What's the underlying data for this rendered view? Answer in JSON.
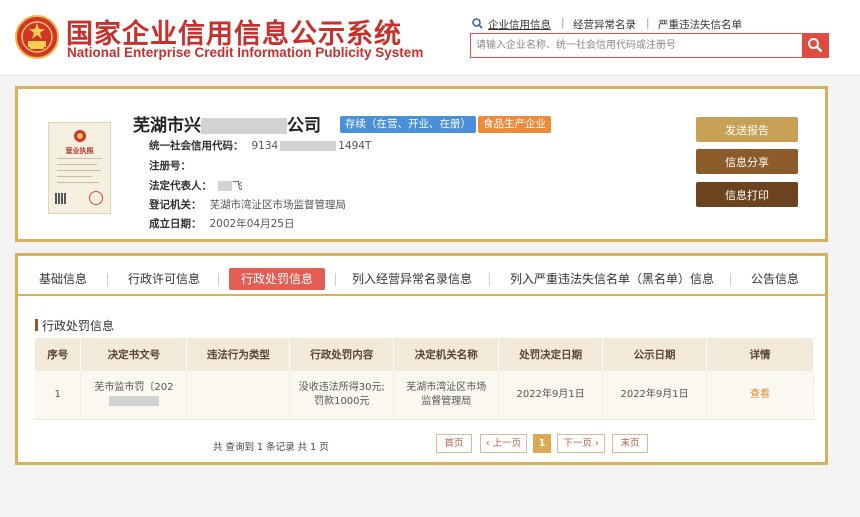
{
  "header": {
    "title_cn": "国家企业信用信息公示系统",
    "title_en": "National Enterprise Credit Information Publicity System",
    "nav": [
      {
        "label": "企业信用信息"
      },
      {
        "label": "经营异常名录"
      },
      {
        "label": "严重违法失信名单"
      }
    ],
    "search": {
      "value": "",
      "placeholder": "请输入企业名称、统一社会信用代码或注册号"
    }
  },
  "company": {
    "license_label": "营业执照",
    "name_visible_prefix": "芜湖市兴",
    "name_visible_suffix": "公司",
    "status_badge": "存续（在营、开业、在册）",
    "type_badge": "食品生产企业",
    "fields": [
      {
        "key": "统一社会信用代码：",
        "value_prefix": "9134",
        "value_suffix": "1494T"
      },
      {
        "key": "注册号：",
        "value_prefix": "",
        "value_suffix": ""
      },
      {
        "key": "法定代表人：",
        "value_prefix": "",
        "value_suffix": "飞"
      },
      {
        "key": "登记机关：",
        "value_prefix": "芜湖市湾沚区市场监督管理局",
        "value_suffix": ""
      },
      {
        "key": "成立日期：",
        "value_prefix": "2002年04月25日",
        "value_suffix": ""
      }
    ],
    "actions": {
      "report": "发送报告",
      "share": "信息分享",
      "print": "信息打印"
    }
  },
  "tabs": [
    {
      "label": "基础信息"
    },
    {
      "label": "行政许可信息"
    },
    {
      "label": "行政处罚信息"
    },
    {
      "label": "列入经营异常名录信息"
    },
    {
      "label": "列入严重违法失信名单（黑名单）信息"
    },
    {
      "label": "公告信息"
    }
  ],
  "section": {
    "title": "行政处罚信息",
    "columns": [
      "序号",
      "决定书文号",
      "违法行为类型",
      "行政处罚内容",
      "决定机关名称",
      "处罚决定日期",
      "公示日期",
      "详情"
    ],
    "rows": [
      {
        "index": "1",
        "doc_no": "芜市监市罚〔202",
        "violation_type": "",
        "penalty_line1": "没收违法所得30元;",
        "penalty_line2": "罚款1000元",
        "authority_line1": "芜湖市湾沚区市场",
        "authority_line2": "监督管理局",
        "decision_date": "2022年9月1日",
        "publish_date": "2022年9月1日",
        "detail": "查看"
      }
    ],
    "pager": {
      "summary": "共 查询到 1 条记录 共 1 页",
      "first": "首页",
      "prev": "‹ 上一页",
      "current": "1",
      "next": "下一页 ›",
      "last": "末页"
    }
  },
  "colors": {
    "brand_red": "#c9302c",
    "gold_border": "#d7b25d",
    "active_tab": "#e35d52",
    "status_blue": "#4a90d9",
    "type_orange": "#ef8a3a"
  }
}
